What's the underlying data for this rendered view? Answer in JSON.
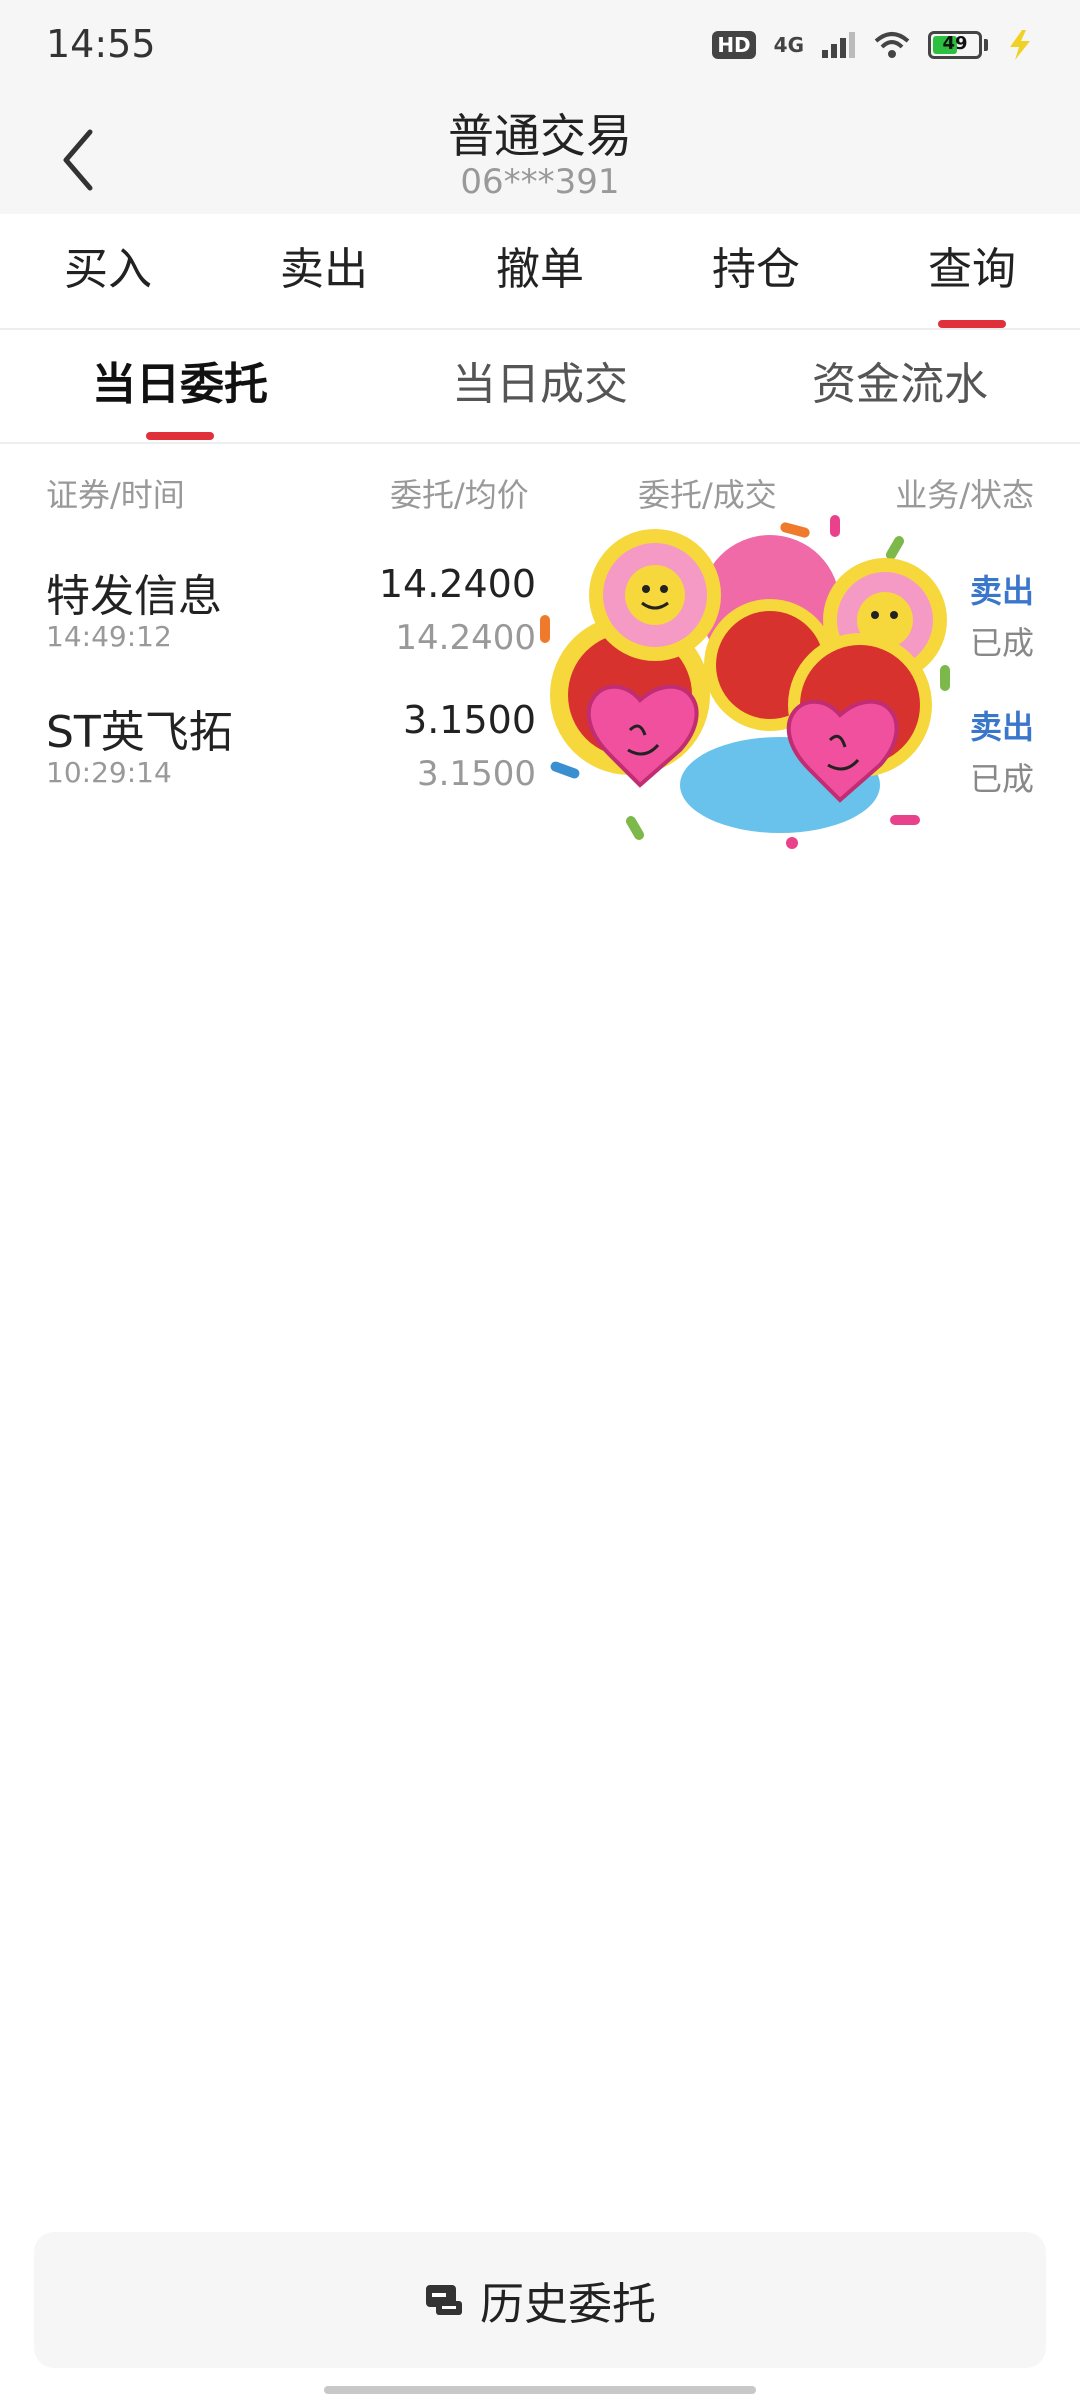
{
  "status_bar": {
    "time": "14:55",
    "hd": "HD",
    "network": "4G",
    "battery": "49",
    "battery_level": 0.49,
    "charging_icon": "lightning-icon"
  },
  "header": {
    "title": "普通交易",
    "account": "06***391",
    "back_icon": "chevron-left-icon"
  },
  "main_tabs": [
    {
      "label": "买入"
    },
    {
      "label": "卖出"
    },
    {
      "label": "撤单"
    },
    {
      "label": "持仓"
    },
    {
      "label": "查询",
      "active": true
    }
  ],
  "sub_tabs": [
    {
      "label": "当日委托",
      "active": true
    },
    {
      "label": "当日成交"
    },
    {
      "label": "资金流水"
    }
  ],
  "table": {
    "headers": [
      "证券/时间",
      "委托/均价",
      "委托/成交",
      "业务/状态"
    ],
    "rows": [
      {
        "name": "特发信息",
        "time": "14:49:12",
        "price": "14.2400",
        "avg": "14.2400",
        "business": "卖出",
        "status": "已成"
      },
      {
        "name": "ST英飞拓",
        "time": "10:29:14",
        "price": "3.1500",
        "avg": "3.1500",
        "business": "卖出",
        "status": "已成"
      }
    ]
  },
  "footer": {
    "history_label": "历史委托",
    "history_icon": "history-icon"
  },
  "colors": {
    "accent": "#e0313b",
    "sell": "#3a76c9",
    "background": "#ffffff",
    "header_bg": "#f6f6f6"
  }
}
